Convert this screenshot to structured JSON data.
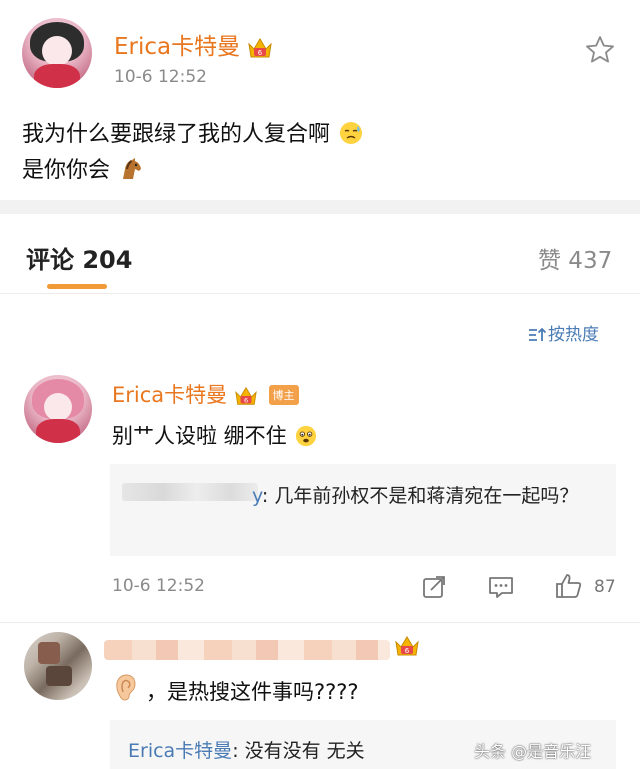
{
  "post": {
    "user_name": "Erica卡特曼",
    "time": "10-6 12:52",
    "line1": "我为什么要跟绿了我的人复合啊",
    "line2": "是你你会"
  },
  "tabs": {
    "comments_label": "评论 204",
    "likes_label": "赞 437"
  },
  "sort": {
    "label": "按热度"
  },
  "comments": [
    {
      "user_name": "Erica卡特曼",
      "badge": "博主",
      "text": "别艹人设啦 绷不住",
      "reply_user": "y",
      "reply_text": ": 几年前孙权不是和蒋清宛在一起吗？",
      "time": "10-6 12:52",
      "like_count": "87"
    },
    {
      "text": "，是热搜这件事吗????",
      "reply_user": "Erica卡特曼",
      "reply_text": ": 没有没有 无关"
    }
  ],
  "watermark": "头条 @是音乐汪",
  "colors": {
    "name_orange": "#e8771f",
    "link_blue": "#4a7bb5",
    "tab_underline": "#f29a36",
    "badge_bg": "#f3a04a"
  },
  "icons": [
    "crown-icon",
    "star-icon",
    "sweat-emoji",
    "horse-emoji",
    "sort-icon",
    "worried-emoji",
    "share-icon",
    "comment-icon",
    "like-icon",
    "ear-emoji"
  ]
}
